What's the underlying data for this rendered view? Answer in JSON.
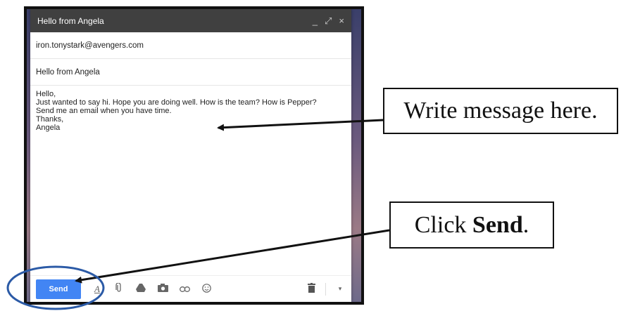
{
  "compose": {
    "title": "Hello from Angela",
    "controls": {
      "minimize": "_",
      "expand": "⤢",
      "close": "×"
    },
    "to": "iron.tonystark@avengers.com",
    "subject": "Hello from Angela",
    "body_lines": [
      "Hello,",
      "Just wanted to say hi. Hope you are doing well. How is the team? How is Pepper?",
      "Send me an email when you have time.",
      "Thanks,",
      "Angela"
    ]
  },
  "toolbar": {
    "send_label": "Send",
    "icons": [
      "format-text-icon",
      "attach-icon",
      "drive-icon",
      "photo-icon",
      "link-icon",
      "emoji-icon",
      "trash-icon",
      "more-options-icon"
    ]
  },
  "callouts": {
    "write": "Write message here.",
    "send_prefix": "Click ",
    "send_bold": "Send",
    "send_suffix": "."
  },
  "colors": {
    "send_button": "#4285f4",
    "title_bar": "#404040",
    "annotation_circle": "#2b5aa6"
  }
}
